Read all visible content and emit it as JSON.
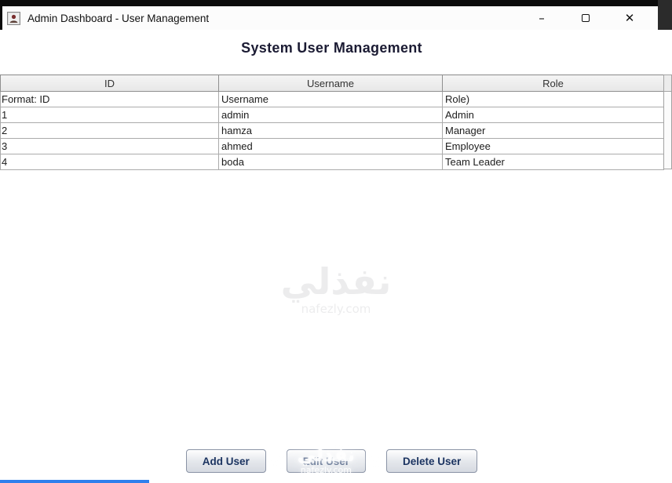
{
  "window": {
    "title": "Admin Dashboard - User Management",
    "controls": {
      "minimize_glyph": "–",
      "close_glyph": "✕"
    }
  },
  "header": {
    "title": "System User Management"
  },
  "table": {
    "columns": [
      "ID",
      "Username",
      "Role"
    ],
    "format_row": {
      "id": "Format: ID",
      "username": "Username",
      "role": "Role)"
    },
    "rows": [
      {
        "id": "1",
        "username": "admin",
        "role": "Admin"
      },
      {
        "id": "2",
        "username": "hamza",
        "role": "Manager"
      },
      {
        "id": "3",
        "username": "ahmed",
        "role": "Employee"
      },
      {
        "id": "4",
        "username": "boda",
        "role": "Team Leader"
      }
    ]
  },
  "buttons": {
    "add": "Add User",
    "edit": "Edit User",
    "delete": "Delete User"
  },
  "watermark": {
    "brand": "نفذلي",
    "domain": "nafezly.com"
  },
  "colors": {
    "accent_blue": "#2f80ed",
    "table_border": "#ababab",
    "header_bg": "#ececec",
    "title_color": "#1b1b33",
    "button_text": "#1c3461"
  }
}
